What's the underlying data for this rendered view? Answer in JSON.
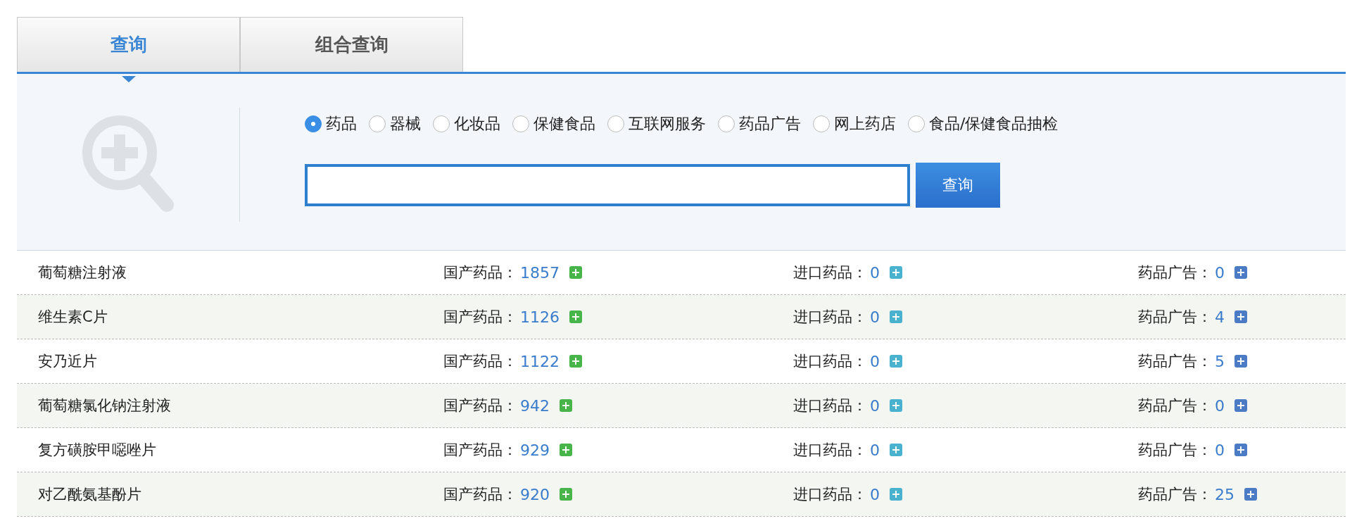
{
  "tabs": [
    {
      "label": "查询",
      "selected": true
    },
    {
      "label": "组合查询",
      "selected": false
    }
  ],
  "categories": [
    {
      "label": "药品",
      "selected": true
    },
    {
      "label": "器械",
      "selected": false
    },
    {
      "label": "化妆品",
      "selected": false
    },
    {
      "label": "保健食品",
      "selected": false
    },
    {
      "label": "互联网服务",
      "selected": false
    },
    {
      "label": "药品广告",
      "selected": false
    },
    {
      "label": "网上药店",
      "selected": false
    },
    {
      "label": "食品/保健食品抽检",
      "selected": false
    }
  ],
  "search_button": "查询",
  "results": [
    {
      "name": "葡萄糖注射液",
      "domestic_label": "国产药品：",
      "domestic": "1857",
      "import_label": "进口药品：",
      "import": "0",
      "ad_label": "药品广告：",
      "ad": "0"
    },
    {
      "name": "维生素C片",
      "domestic_label": "国产药品：",
      "domestic": "1126",
      "import_label": "进口药品：",
      "import": "0",
      "ad_label": "药品广告：",
      "ad": "4"
    },
    {
      "name": "安乃近片",
      "domestic_label": "国产药品：",
      "domestic": "1122",
      "import_label": "进口药品：",
      "import": "0",
      "ad_label": "药品广告：",
      "ad": "5"
    },
    {
      "name": "葡萄糖氯化钠注射液",
      "domestic_label": "国产药品：",
      "domestic": "942",
      "import_label": "进口药品：",
      "import": "0",
      "ad_label": "药品广告：",
      "ad": "0"
    },
    {
      "name": "复方磺胺甲噁唑片",
      "domestic_label": "国产药品：",
      "domestic": "929",
      "import_label": "进口药品：",
      "import": "0",
      "ad_label": "药品广告：",
      "ad": "0"
    },
    {
      "name": "对乙酰氨基酚片",
      "domestic_label": "国产药品：",
      "domestic": "920",
      "import_label": "进口药品：",
      "import": "0",
      "ad_label": "药品广告：",
      "ad": "25"
    }
  ]
}
